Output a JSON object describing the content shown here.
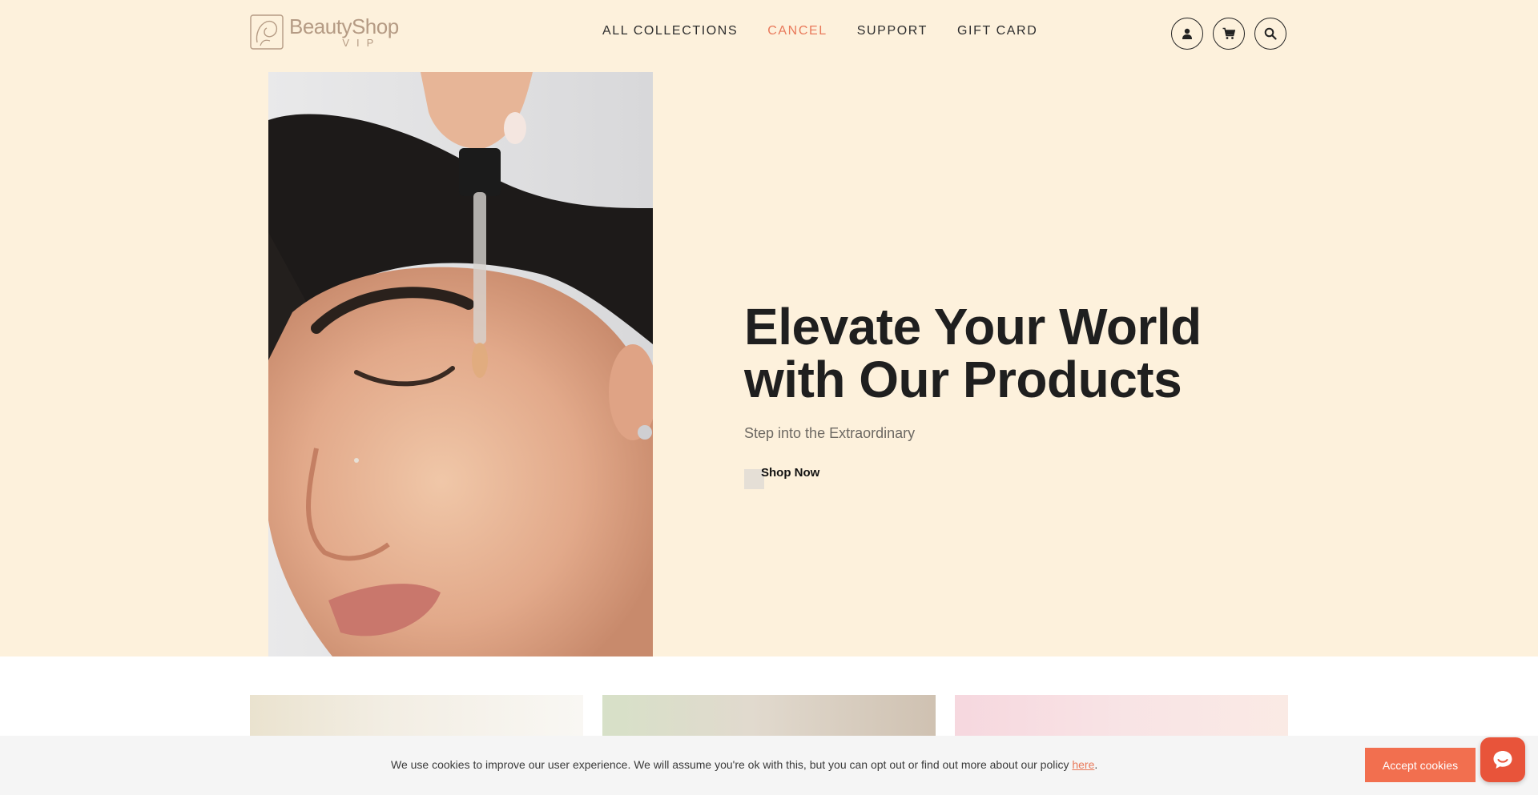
{
  "brand": {
    "name": "BeautyShop",
    "sub": "VIP"
  },
  "nav": {
    "items": [
      {
        "label": "ALL COLLECTIONS",
        "active": false
      },
      {
        "label": "CANCEL",
        "active": true
      },
      {
        "label": "SUPPORT",
        "active": false
      },
      {
        "label": "GIFT CARD",
        "active": false
      }
    ]
  },
  "header_icons": [
    "user-icon",
    "cart-icon",
    "search-icon"
  ],
  "hero": {
    "title": "Elevate Your World with Our Products",
    "subtitle": "Step into the Extraordinary",
    "cta_label": "Shop Now"
  },
  "cookie": {
    "text": "We use cookies to improve our user experience. We will assume you're ok with this, but you can opt out or find out more about our policy ",
    "link_label": "here",
    "trailing": ".",
    "accept_label": "Accept cookies"
  },
  "colors": {
    "hero_background": "#fdf1dc",
    "accent": "#e9795a",
    "accept_button": "#f26f4f",
    "chat_button": "#e8543a"
  }
}
